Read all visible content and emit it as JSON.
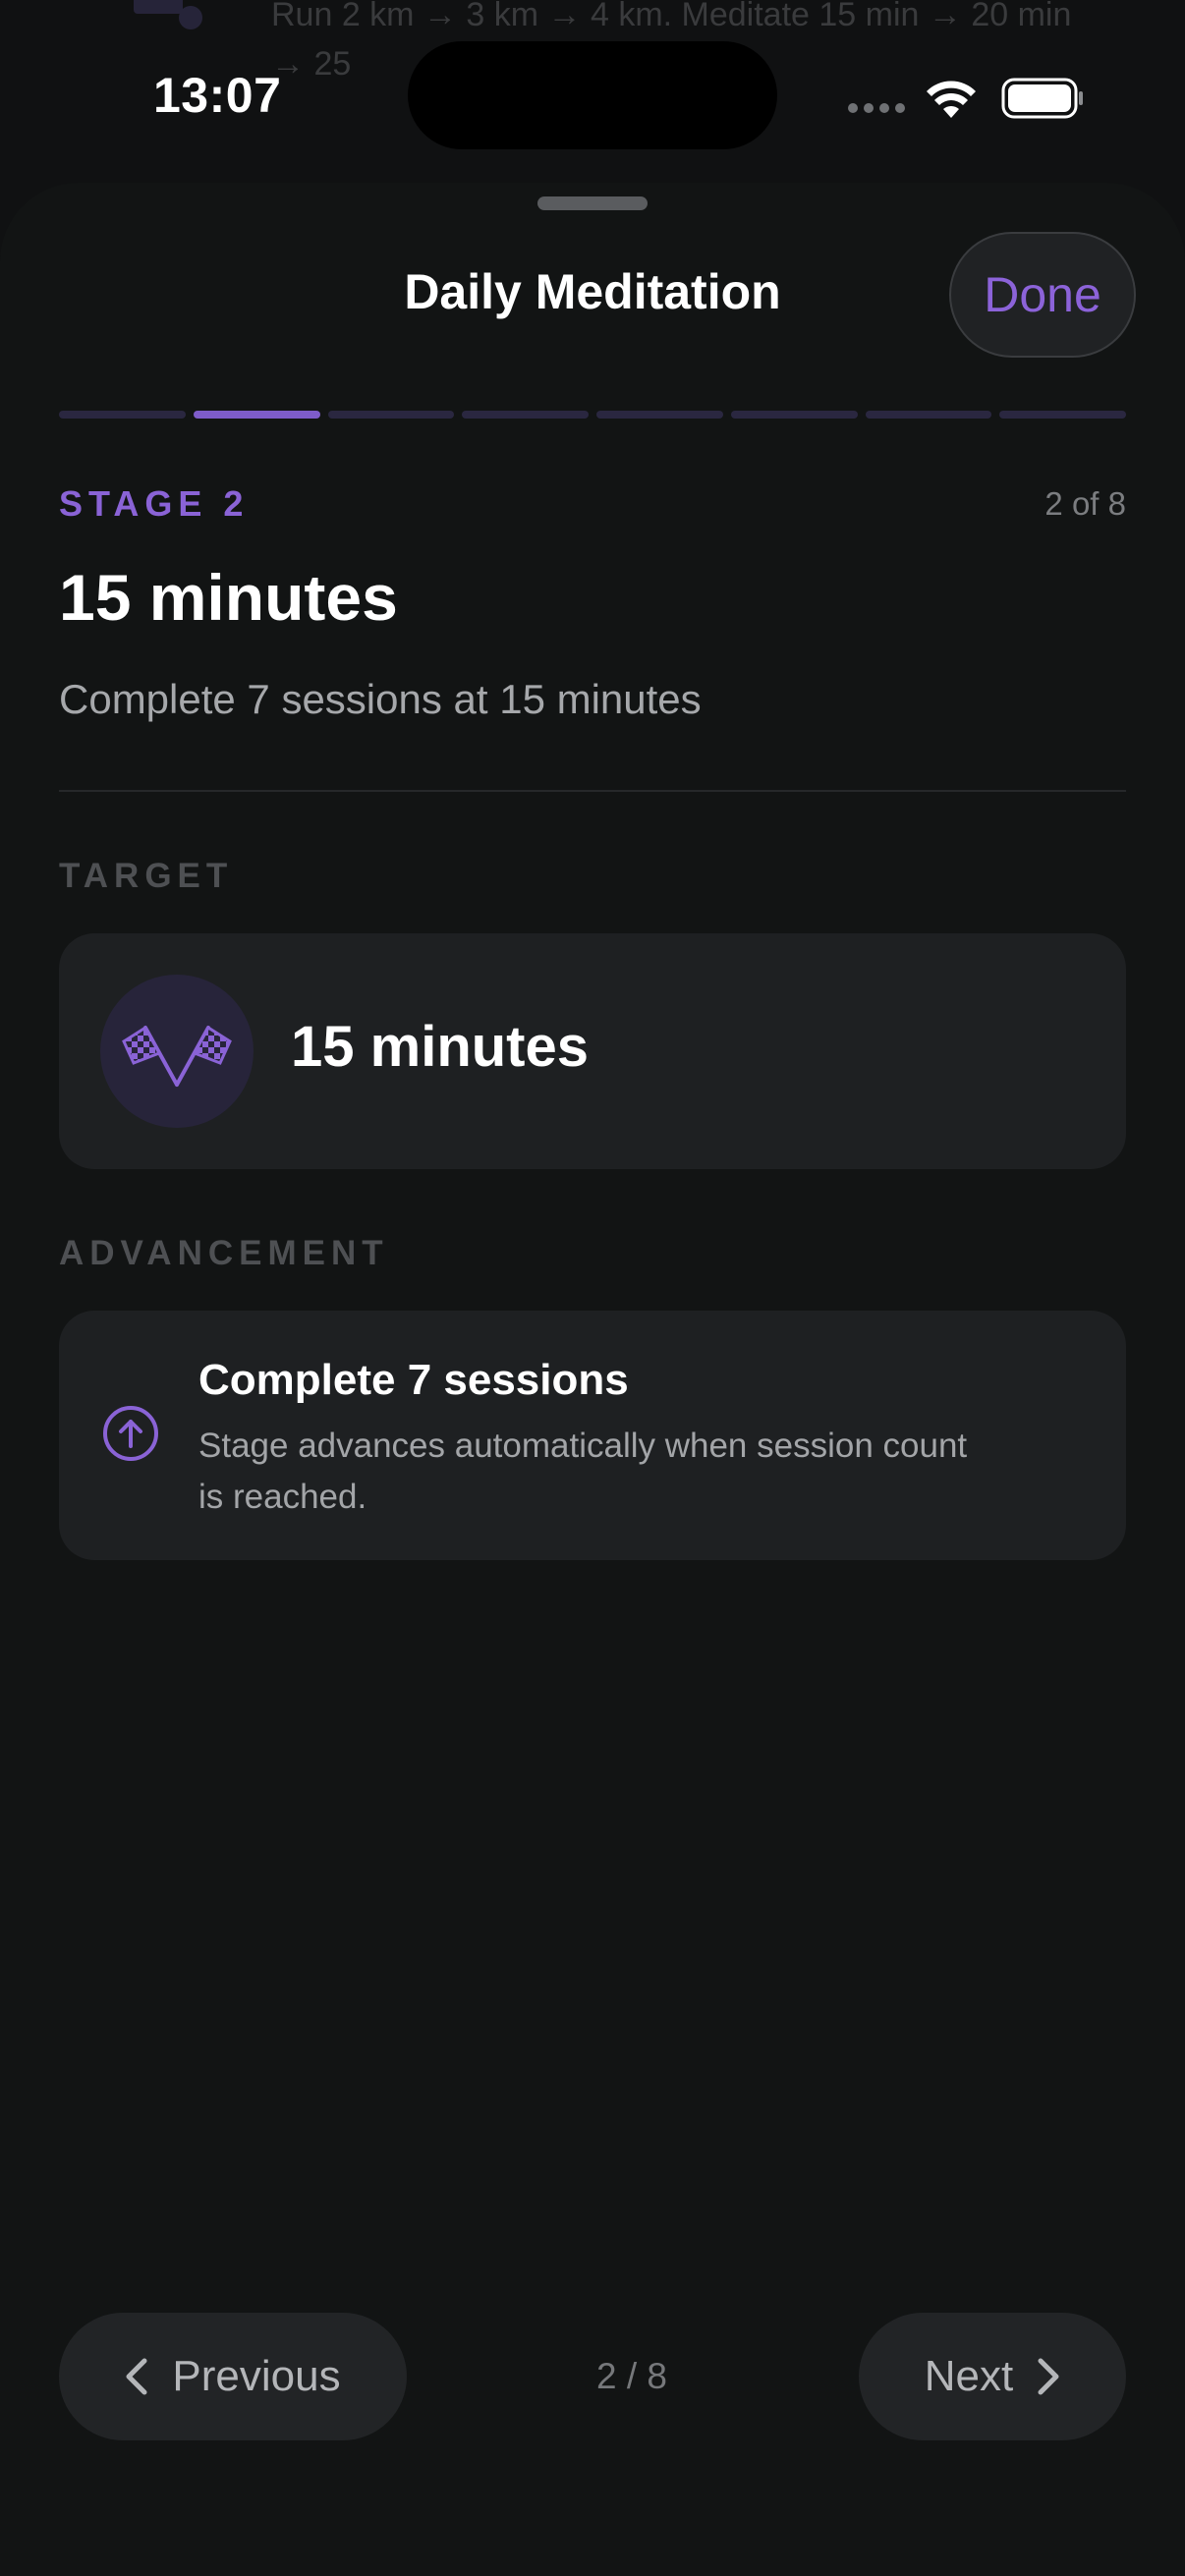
{
  "background": {
    "text": "Run 2 km → 3 km → 4 km. Meditate 15 min → 20 min → 25"
  },
  "status_bar": {
    "time": "13:07"
  },
  "sheet": {
    "title": "Daily Meditation",
    "done_label": "Done",
    "progress": {
      "current": 2,
      "total": 8
    },
    "stage_label": "STAGE 2",
    "stage_count": "2 of 8",
    "stage_title": "15 minutes",
    "stage_description": "Complete 7 sessions at 15 minutes",
    "target": {
      "section_label": "TARGET",
      "icon": "checkered-flags-icon",
      "value": "15 minutes"
    },
    "advancement": {
      "section_label": "ADVANCEMENT",
      "icon": "arrow-up-circle-icon",
      "title": "Complete 7 sessions",
      "description": "Stage advances automatically when session count is reached."
    },
    "nav": {
      "previous_label": "Previous",
      "next_label": "Next",
      "pager": "2 / 8"
    }
  },
  "colors": {
    "accent": "#8c63d9",
    "background": "#121414",
    "card": "#1e2022"
  }
}
